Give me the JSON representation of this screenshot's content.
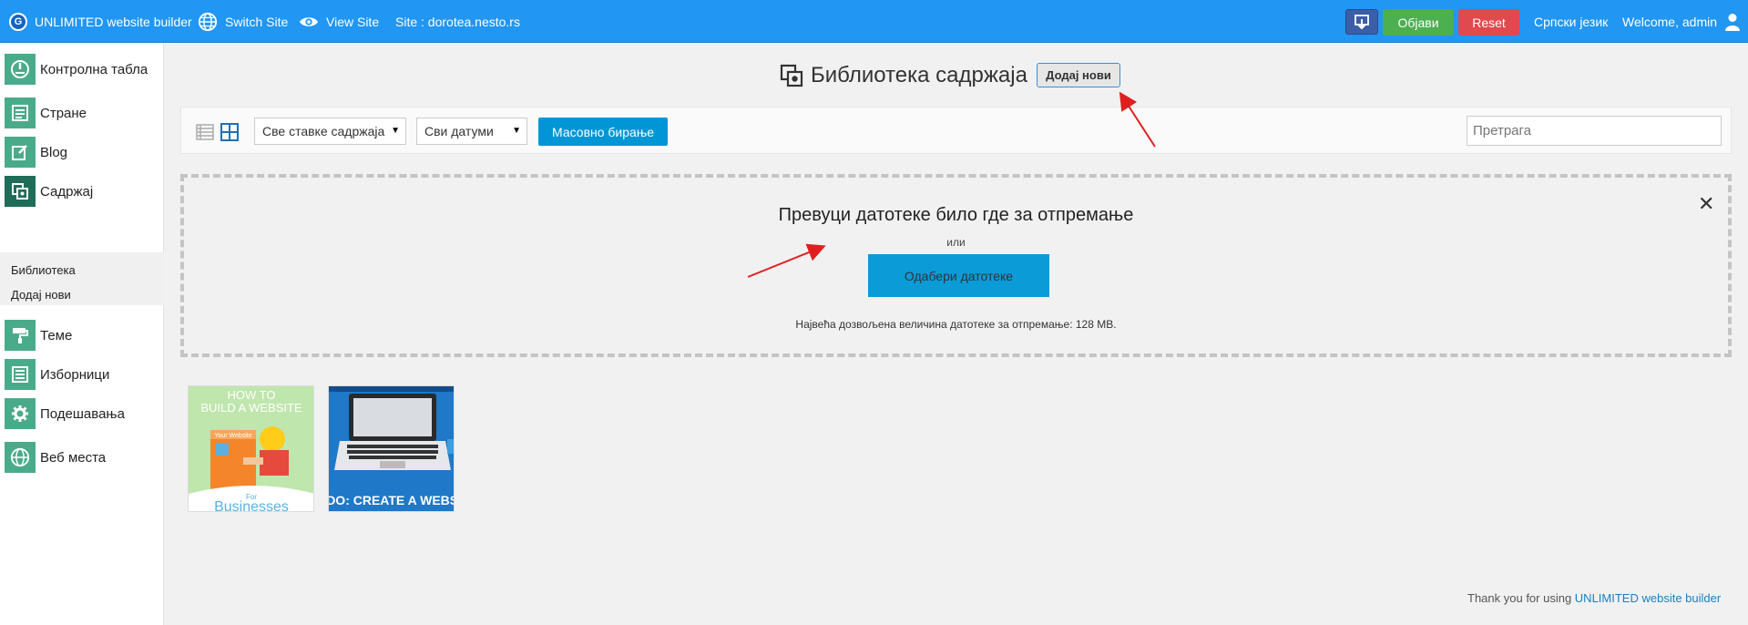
{
  "topbar": {
    "brand": "UNLIMITED website builder",
    "switch_site": "Switch Site",
    "view_site": "View Site",
    "site_label": "Site : dorotea.nesto.rs",
    "publish": "Објави",
    "reset": "Reset",
    "language": "Српски језик",
    "welcome": "Welcome, admin"
  },
  "sidebar": {
    "items": [
      {
        "label": "Контролна табла",
        "icon": "dashboard-icon"
      },
      {
        "label": "Стране",
        "icon": "pages-icon"
      },
      {
        "label": "Blog",
        "icon": "blog-icon"
      },
      {
        "label": "Садржај",
        "icon": "media-icon"
      },
      {
        "label": "Теме",
        "icon": "themes-icon"
      },
      {
        "label": "Изборници",
        "icon": "menus-icon"
      },
      {
        "label": "Подешавања",
        "icon": "settings-icon"
      },
      {
        "label": "Веб места",
        "icon": "sites-icon"
      }
    ],
    "submenu": [
      "Библиотека",
      "Додај нови"
    ]
  },
  "main": {
    "title": "Библиотека садржаја",
    "add_new": "Додај нови",
    "toolbar": {
      "filter_items": "Све ставке садржаја",
      "filter_dates": "Сви датуми",
      "bulk_select": "Масовно бирање",
      "search_placeholder": "Претрага"
    },
    "dropzone": {
      "title": "Превуци датотеке било где за отпремање",
      "or": "или",
      "select_files": "Одабери датотеке",
      "max_size": "Највећа дозвољена величина датотеке за отпремање: 128 MB."
    },
    "thumbnails": [
      {
        "top_text": "HOW TO\nBUILD A WEBSITE",
        "sign": "Your Website",
        "for": "For",
        "bottom": "Businesses"
      },
      {
        "bottom": "TO DO: CREATE A WEBSITE"
      }
    ]
  },
  "footer": {
    "prefix": "Thank you for using ",
    "link": "UNLIMITED website builder"
  }
}
